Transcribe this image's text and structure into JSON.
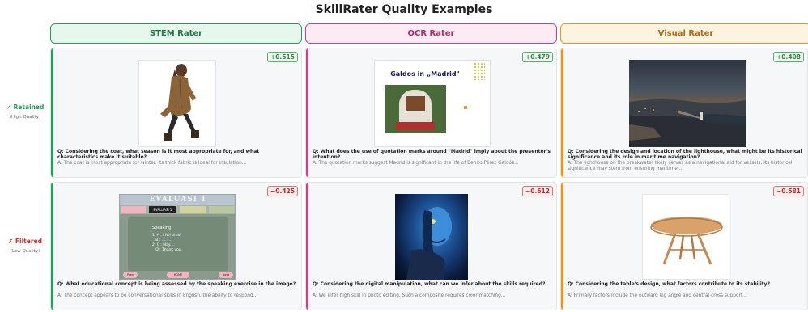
{
  "title": "SkillRater Quality Examples",
  "colors": {
    "stem": "#22a05a",
    "ocr": "#d63b8a",
    "visual": "#e8951e",
    "retained": "#22a05a",
    "filtered": "#d62b2b"
  },
  "columns": [
    {
      "name": "STEM Rater"
    },
    {
      "name": "OCR Rater"
    },
    {
      "name": "Visual Rater"
    }
  ],
  "rows": [
    {
      "label": "✓ Retained",
      "sub": "(High Quality)"
    },
    {
      "label": "✗ Filtered",
      "sub": "(Low Quality)"
    }
  ],
  "cards": {
    "r0c0": {
      "score": "+0.515",
      "image": "woman-in-brown-coat",
      "question": "Q: Considering the coat, what season is it most appropriate for, and what characteristics make it suitable?",
      "answer": "A: The coat is most appropriate for winter. Its thick fabric is ideal for insulation..."
    },
    "r0c1": {
      "score": "+0.479",
      "image": "galdos-madrid-slide",
      "slide_title": "Galdos in „Madrid\"",
      "question": "Q: What does the use of quotation marks around \"Madrid\" imply about the presenter's intention?",
      "answer": "A: The quotation marks suggest Madrid is significant in the life of Benito Pérez Galdós..."
    },
    "r0c2": {
      "score": "+0.408",
      "image": "lighthouse-aerial",
      "question": "Q: Considering the design and location of the lighthouse, what might be its historical significance and its role in maritime navigation?",
      "answer": "A: The lighthouse on the breakwater likely serves as a navigational aid for vessels. Its historical significance may stem from ensuring maritime..."
    },
    "r1c0": {
      "score": "−0.425",
      "image": "evaluasi-slide",
      "slide_title": "EVALUASI 1",
      "slide_tab": "EVALUASI 1",
      "slide_heading": "Speaking",
      "slide_lines": [
        "1. A : I fell tired",
        "   B : ........",
        "2. C : May....",
        "   D : Thank you."
      ],
      "slide_buttons": [
        "Prev",
        "HOME",
        "Next"
      ],
      "question": "Q: What educational concept is being assessed by the speaking exercise in the image?",
      "answer": "A: The concept appears to be conversational skills in English, the ability to respond..."
    },
    "r1c1": {
      "score": "−0.612",
      "image": "blue-avatar-portrait",
      "question": "Q: Considering the digital manipulation, what can we infer about the skills required?",
      "answer": "A: We infer high skill in photo editing. Such a composite requires color matching..."
    },
    "r1c2": {
      "score": "−0.581",
      "image": "wooden-round-table",
      "question": "Q: Considering the table's design, what factors contribute to its stability?",
      "answer": "A: Primary factors include the outward leg angle and central cross support..."
    }
  }
}
